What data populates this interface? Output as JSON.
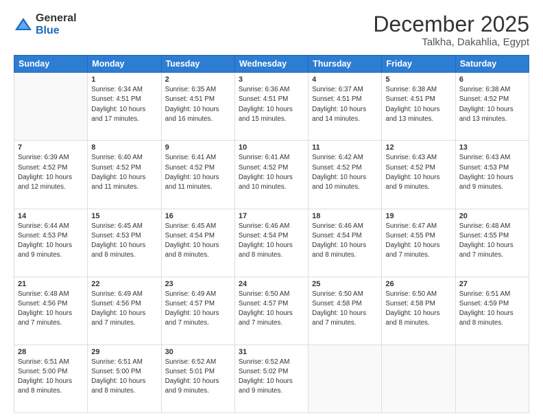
{
  "logo": {
    "general": "General",
    "blue": "Blue"
  },
  "header": {
    "month": "December 2025",
    "location": "Talkha, Dakahlia, Egypt"
  },
  "weekdays": [
    "Sunday",
    "Monday",
    "Tuesday",
    "Wednesday",
    "Thursday",
    "Friday",
    "Saturday"
  ],
  "weeks": [
    [
      {
        "day": "",
        "empty": true
      },
      {
        "day": "1",
        "sunrise": "6:34 AM",
        "sunset": "4:51 PM",
        "daylight": "10 hours and 17 minutes."
      },
      {
        "day": "2",
        "sunrise": "6:35 AM",
        "sunset": "4:51 PM",
        "daylight": "10 hours and 16 minutes."
      },
      {
        "day": "3",
        "sunrise": "6:36 AM",
        "sunset": "4:51 PM",
        "daylight": "10 hours and 15 minutes."
      },
      {
        "day": "4",
        "sunrise": "6:37 AM",
        "sunset": "4:51 PM",
        "daylight": "10 hours and 14 minutes."
      },
      {
        "day": "5",
        "sunrise": "6:38 AM",
        "sunset": "4:51 PM",
        "daylight": "10 hours and 13 minutes."
      },
      {
        "day": "6",
        "sunrise": "6:38 AM",
        "sunset": "4:52 PM",
        "daylight": "10 hours and 13 minutes."
      }
    ],
    [
      {
        "day": "7",
        "sunrise": "6:39 AM",
        "sunset": "4:52 PM",
        "daylight": "10 hours and 12 minutes."
      },
      {
        "day": "8",
        "sunrise": "6:40 AM",
        "sunset": "4:52 PM",
        "daylight": "10 hours and 11 minutes."
      },
      {
        "day": "9",
        "sunrise": "6:41 AM",
        "sunset": "4:52 PM",
        "daylight": "10 hours and 11 minutes."
      },
      {
        "day": "10",
        "sunrise": "6:41 AM",
        "sunset": "4:52 PM",
        "daylight": "10 hours and 10 minutes."
      },
      {
        "day": "11",
        "sunrise": "6:42 AM",
        "sunset": "4:52 PM",
        "daylight": "10 hours and 10 minutes."
      },
      {
        "day": "12",
        "sunrise": "6:43 AM",
        "sunset": "4:52 PM",
        "daylight": "10 hours and 9 minutes."
      },
      {
        "day": "13",
        "sunrise": "6:43 AM",
        "sunset": "4:53 PM",
        "daylight": "10 hours and 9 minutes."
      }
    ],
    [
      {
        "day": "14",
        "sunrise": "6:44 AM",
        "sunset": "4:53 PM",
        "daylight": "10 hours and 9 minutes."
      },
      {
        "day": "15",
        "sunrise": "6:45 AM",
        "sunset": "4:53 PM",
        "daylight": "10 hours and 8 minutes."
      },
      {
        "day": "16",
        "sunrise": "6:45 AM",
        "sunset": "4:54 PM",
        "daylight": "10 hours and 8 minutes."
      },
      {
        "day": "17",
        "sunrise": "6:46 AM",
        "sunset": "4:54 PM",
        "daylight": "10 hours and 8 minutes."
      },
      {
        "day": "18",
        "sunrise": "6:46 AM",
        "sunset": "4:54 PM",
        "daylight": "10 hours and 8 minutes."
      },
      {
        "day": "19",
        "sunrise": "6:47 AM",
        "sunset": "4:55 PM",
        "daylight": "10 hours and 7 minutes."
      },
      {
        "day": "20",
        "sunrise": "6:48 AM",
        "sunset": "4:55 PM",
        "daylight": "10 hours and 7 minutes."
      }
    ],
    [
      {
        "day": "21",
        "sunrise": "6:48 AM",
        "sunset": "4:56 PM",
        "daylight": "10 hours and 7 minutes."
      },
      {
        "day": "22",
        "sunrise": "6:49 AM",
        "sunset": "4:56 PM",
        "daylight": "10 hours and 7 minutes."
      },
      {
        "day": "23",
        "sunrise": "6:49 AM",
        "sunset": "4:57 PM",
        "daylight": "10 hours and 7 minutes."
      },
      {
        "day": "24",
        "sunrise": "6:50 AM",
        "sunset": "4:57 PM",
        "daylight": "10 hours and 7 minutes."
      },
      {
        "day": "25",
        "sunrise": "6:50 AM",
        "sunset": "4:58 PM",
        "daylight": "10 hours and 7 minutes."
      },
      {
        "day": "26",
        "sunrise": "6:50 AM",
        "sunset": "4:58 PM",
        "daylight": "10 hours and 8 minutes."
      },
      {
        "day": "27",
        "sunrise": "6:51 AM",
        "sunset": "4:59 PM",
        "daylight": "10 hours and 8 minutes."
      }
    ],
    [
      {
        "day": "28",
        "sunrise": "6:51 AM",
        "sunset": "5:00 PM",
        "daylight": "10 hours and 8 minutes."
      },
      {
        "day": "29",
        "sunrise": "6:51 AM",
        "sunset": "5:00 PM",
        "daylight": "10 hours and 8 minutes."
      },
      {
        "day": "30",
        "sunrise": "6:52 AM",
        "sunset": "5:01 PM",
        "daylight": "10 hours and 9 minutes."
      },
      {
        "day": "31",
        "sunrise": "6:52 AM",
        "sunset": "5:02 PM",
        "daylight": "10 hours and 9 minutes."
      },
      {
        "day": "",
        "empty": true
      },
      {
        "day": "",
        "empty": true
      },
      {
        "day": "",
        "empty": true
      }
    ]
  ]
}
